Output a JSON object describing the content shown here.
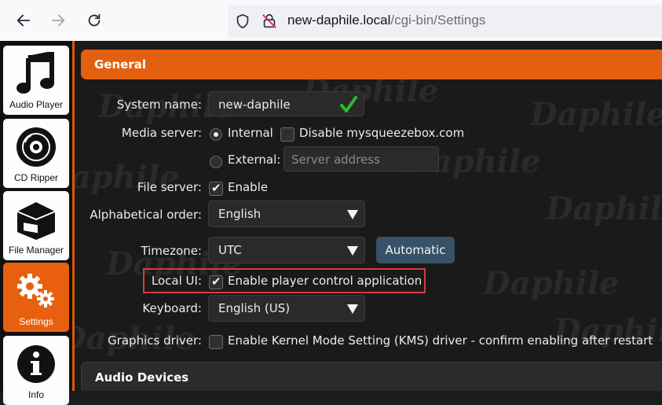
{
  "browser": {
    "url_host": "new-daphile.local",
    "url_path": "/cgi-bin/Settings"
  },
  "sidebar": {
    "items": [
      {
        "label": "Audio Player",
        "icon": "music-note-icon"
      },
      {
        "label": "CD Ripper",
        "icon": "cd-disc-icon"
      },
      {
        "label": "File Manager",
        "icon": "box-folder-icon"
      },
      {
        "label": "Settings",
        "icon": "gears-icon",
        "active": true
      },
      {
        "label": "Info",
        "icon": "info-icon"
      }
    ]
  },
  "watermark": "Daphile",
  "general": {
    "title": "General",
    "system_name_label": "System name:",
    "system_name_value": "new-daphile",
    "media_server_label": "Media server:",
    "internal_label": "Internal",
    "disable_mysqueezebox_label": "Disable mysqueezebox.com",
    "external_label": "External:",
    "server_address_placeholder": "Server address",
    "file_server_label": "File server:",
    "file_server_enable_label": "Enable",
    "alpha_order_label": "Alphabetical order:",
    "alpha_order_value": "English",
    "timezone_label": "Timezone:",
    "timezone_value": "UTC",
    "automatic_button": "Automatic",
    "local_ui_label": "Local UI:",
    "local_ui_option_label": "Enable player control application",
    "keyboard_label": "Keyboard:",
    "keyboard_value": "English (US)",
    "graphics_label": "Graphics driver:",
    "graphics_option_label": "Enable Kernel Mode Setting (KMS) driver - confirm enabling after restart"
  },
  "audio_devices": {
    "title": "Audio Devices"
  },
  "colors": {
    "accent": "#e2600f",
    "highlight": "#d73c3c"
  }
}
